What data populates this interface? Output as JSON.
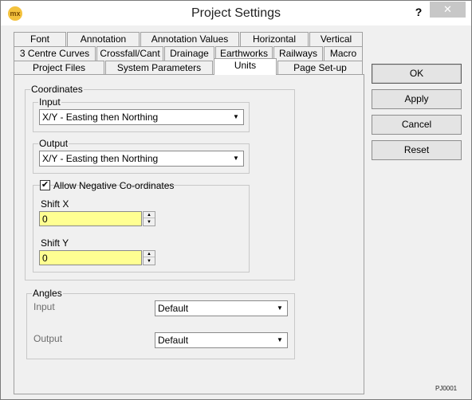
{
  "window": {
    "title": "Project Settings",
    "app_icon": "mx",
    "help": "?",
    "close": "✕"
  },
  "tabs": {
    "row1": [
      "Font",
      "Annotation",
      "Annotation Values",
      "Horizontal",
      "Vertical"
    ],
    "row2": [
      "3 Centre Curves",
      "Crossfall/Cant",
      "Drainage",
      "Earthworks",
      "Railways",
      "Macro"
    ],
    "row3": [
      "Project Files",
      "System Parameters",
      "Units",
      "Page Set-up"
    ],
    "active": "Units"
  },
  "coordinates": {
    "label": "Coordinates",
    "input_label": "Input",
    "input_value": "X/Y - Easting then Northing",
    "output_label": "Output",
    "output_value": "X/Y - Easting then Northing",
    "allow_negative_label": "Allow Negative Co-ordinates",
    "allow_negative_checked": "✔",
    "shift_x_label": "Shift X",
    "shift_x_value": "0",
    "shift_y_label": "Shift Y",
    "shift_y_value": "0"
  },
  "angles": {
    "label": "Angles",
    "input_label": "Input",
    "input_value": "Default",
    "output_label": "Output",
    "output_value": "Default"
  },
  "buttons": {
    "ok": "OK",
    "apply": "Apply",
    "cancel": "Cancel",
    "reset": "Reset"
  },
  "code": "PJ0001",
  "colors": {
    "highlight": "#f4f55a",
    "field_highlight": "#ffff92"
  }
}
